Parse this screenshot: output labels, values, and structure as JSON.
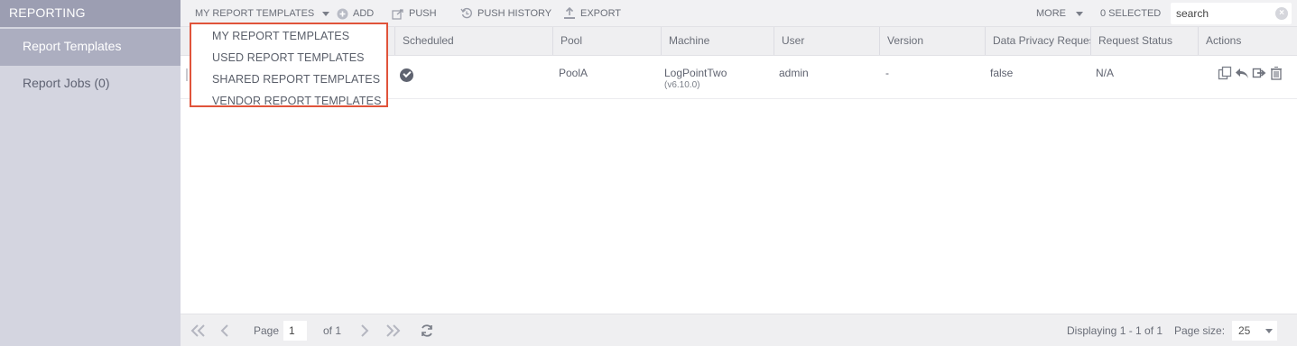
{
  "sidebar": {
    "header": "REPORTING",
    "items": [
      {
        "label": "Report Templates",
        "active": true
      },
      {
        "label": "Report Jobs (0)",
        "active": false
      }
    ]
  },
  "toolbar": {
    "templates_menu": "MY REPORT TEMPLATES",
    "add": "ADD",
    "push": "PUSH",
    "push_history": "PUSH HISTORY",
    "export": "EXPORT",
    "more": "MORE",
    "selected": "0 SELECTED",
    "search_placeholder": "search",
    "search_value": "search"
  },
  "dropdown": {
    "items": [
      "MY REPORT TEMPLATES",
      "USED REPORT TEMPLATES",
      "SHARED REPORT TEMPLATES",
      "VENDOR REPORT TEMPLATES"
    ]
  },
  "grid": {
    "columns": [
      "Scheduled",
      "Pool",
      "Machine",
      "User",
      "Version",
      "Data Privacy Reques",
      "Request Status",
      "Actions"
    ],
    "rows": [
      {
        "scheduled": true,
        "pool": "PoolA",
        "machine": "LogPointTwo",
        "machine_version": "(v6.10.0)",
        "user": "admin",
        "version": "-",
        "data_privacy": "false",
        "request_status": "N/A"
      }
    ]
  },
  "footer": {
    "page_label": "Page",
    "page_value": "1",
    "of_label": "of 1",
    "displaying": "Displaying 1 - 1 of 1",
    "page_size_label": "Page size:",
    "page_size_value": "25"
  },
  "colors": {
    "sidebar_bg": "#d4d5e0",
    "sidebar_header": "#9c9eb2",
    "active_item": "#acaec0",
    "highlight_border": "#e0533a"
  }
}
